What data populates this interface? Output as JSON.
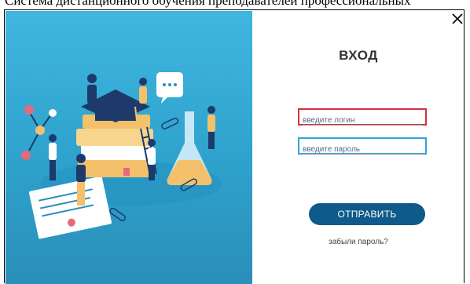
{
  "page_top_text": "Система дистанционного обучения преподавателей профессиональных",
  "modal": {
    "title": "ВХОД",
    "login_placeholder": "введите логин",
    "password_placeholder": "введите пароль",
    "submit_label": "ОТПРАВИТЬ",
    "forgot_label": "забыли пароль?",
    "close_icon": "close-icon"
  },
  "colors": {
    "illustration_bg": "#3fb6e0",
    "login_border": "#d6303f",
    "password_border": "#2fa4dc",
    "submit_bg": "#0e5a8a"
  }
}
